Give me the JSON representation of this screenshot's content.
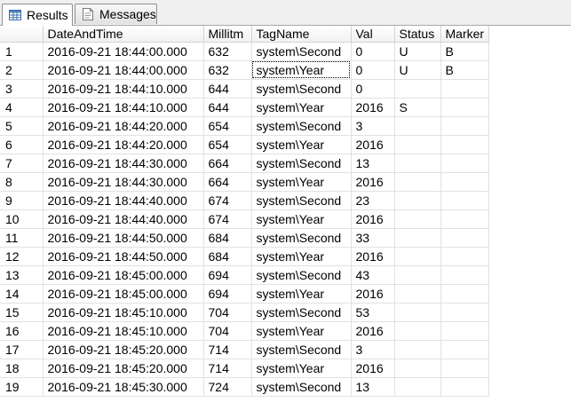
{
  "tabs": [
    {
      "label": "Results",
      "icon": "grid-icon",
      "active": true
    },
    {
      "label": "Messages",
      "icon": "messages-icon",
      "active": false
    }
  ],
  "grid": {
    "columns": [
      "",
      "DateAndTime",
      "Millitm",
      "TagName",
      "Val",
      "Status",
      "Marker"
    ],
    "rows": [
      [
        "1",
        "2016-09-21 18:44:00.000",
        "632",
        "system\\Second",
        "0",
        "U",
        "B"
      ],
      [
        "2",
        "2016-09-21 18:44:00.000",
        "632",
        "system\\Year",
        "0",
        "U",
        "B"
      ],
      [
        "3",
        "2016-09-21 18:44:10.000",
        "644",
        "system\\Second",
        "0",
        "",
        ""
      ],
      [
        "4",
        "2016-09-21 18:44:10.000",
        "644",
        "system\\Year",
        "2016",
        "S",
        ""
      ],
      [
        "5",
        "2016-09-21 18:44:20.000",
        "654",
        "system\\Second",
        "3",
        "",
        ""
      ],
      [
        "6",
        "2016-09-21 18:44:20.000",
        "654",
        "system\\Year",
        "2016",
        "",
        ""
      ],
      [
        "7",
        "2016-09-21 18:44:30.000",
        "664",
        "system\\Second",
        "13",
        "",
        ""
      ],
      [
        "8",
        "2016-09-21 18:44:30.000",
        "664",
        "system\\Year",
        "2016",
        "",
        ""
      ],
      [
        "9",
        "2016-09-21 18:44:40.000",
        "674",
        "system\\Second",
        "23",
        "",
        ""
      ],
      [
        "10",
        "2016-09-21 18:44:40.000",
        "674",
        "system\\Year",
        "2016",
        "",
        ""
      ],
      [
        "11",
        "2016-09-21 18:44:50.000",
        "684",
        "system\\Second",
        "33",
        "",
        ""
      ],
      [
        "12",
        "2016-09-21 18:44:50.000",
        "684",
        "system\\Year",
        "2016",
        "",
        ""
      ],
      [
        "13",
        "2016-09-21 18:45:00.000",
        "694",
        "system\\Second",
        "43",
        "",
        ""
      ],
      [
        "14",
        "2016-09-21 18:45:00.000",
        "694",
        "system\\Year",
        "2016",
        "",
        ""
      ],
      [
        "15",
        "2016-09-21 18:45:10.000",
        "704",
        "system\\Second",
        "53",
        "",
        ""
      ],
      [
        "16",
        "2016-09-21 18:45:10.000",
        "704",
        "system\\Year",
        "2016",
        "",
        ""
      ],
      [
        "17",
        "2016-09-21 18:45:20.000",
        "714",
        "system\\Second",
        "3",
        "",
        ""
      ],
      [
        "18",
        "2016-09-21 18:45:20.000",
        "714",
        "system\\Year",
        "2016",
        "",
        ""
      ],
      [
        "19",
        "2016-09-21 18:45:30.000",
        "724",
        "system\\Second",
        "13",
        "",
        ""
      ]
    ],
    "selected_cell": {
      "row": 1,
      "col": 3
    }
  }
}
